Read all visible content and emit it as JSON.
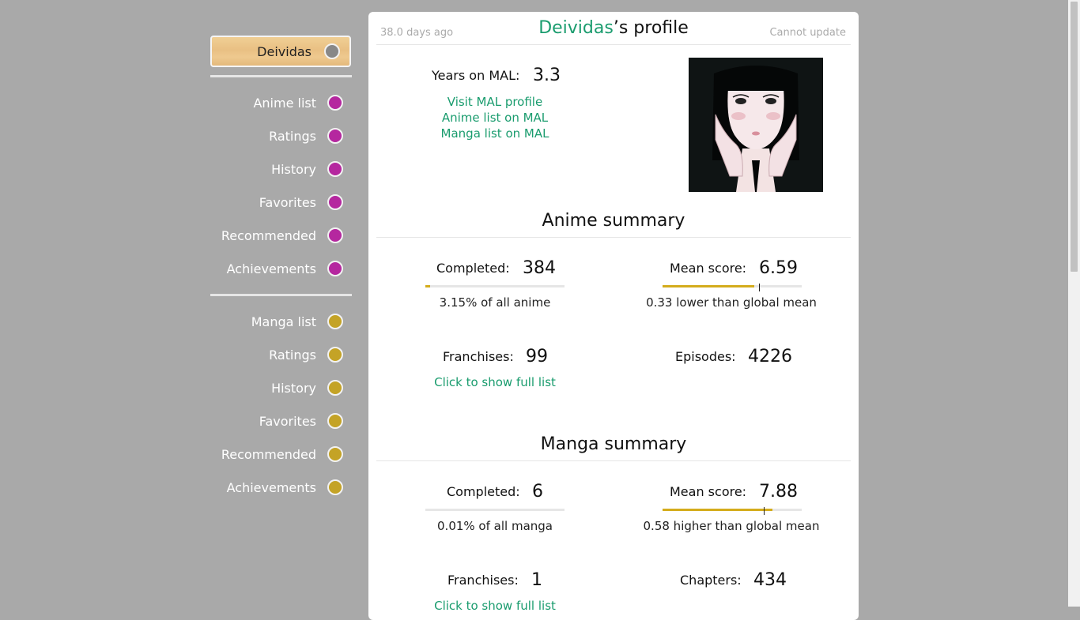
{
  "sidebar": {
    "user": {
      "label": "Deividas",
      "dot_color": "#888888"
    },
    "anime_items": [
      {
        "label": "Anime list"
      },
      {
        "label": "Ratings"
      },
      {
        "label": "History"
      },
      {
        "label": "Favorites"
      },
      {
        "label": "Recommended"
      },
      {
        "label": "Achievements"
      }
    ],
    "manga_items": [
      {
        "label": "Manga list"
      },
      {
        "label": "Ratings"
      },
      {
        "label": "History"
      },
      {
        "label": "Favorites"
      },
      {
        "label": "Recommended"
      },
      {
        "label": "Achievements"
      }
    ],
    "anime_color": "#b5279f",
    "manga_color": "#c4a326"
  },
  "header": {
    "updated": "38.0 days ago",
    "username": "Deividas",
    "title_suffix": "’s profile",
    "cannot_update": "Cannot update"
  },
  "profile": {
    "years_label": "Years on MAL:",
    "years_value": "3.3",
    "links": [
      "Visit MAL profile",
      "Anime list on MAL",
      "Manga list on MAL"
    ]
  },
  "anime": {
    "title": "Anime summary",
    "completed_label": "Completed:",
    "completed_value": "384",
    "completed_fraction": 0.0315,
    "completed_sub": "3.15% of all anime",
    "mean_label": "Mean score:",
    "mean_value": "6.59",
    "mean_fill": 0.659,
    "global_mean": 0.692,
    "mean_sub": "0.33 lower than global mean",
    "franchises_label": "Franchises:",
    "franchises_value": "99",
    "franchises_link": "Click to show full list",
    "episodes_label": "Episodes:",
    "episodes_value": "4226"
  },
  "manga": {
    "title": "Manga summary",
    "completed_label": "Completed:",
    "completed_value": "6",
    "completed_fraction": 0.0001,
    "completed_sub": "0.01% of all manga",
    "mean_label": "Mean score:",
    "mean_value": "7.88",
    "mean_fill": 0.788,
    "global_mean": 0.73,
    "mean_sub": "0.58 higher than global mean",
    "franchises_label": "Franchises:",
    "franchises_value": "1",
    "franchises_link": "Click to show full list",
    "chapters_label": "Chapters:",
    "chapters_value": "434"
  },
  "colors": {
    "accent_green": "#1a9c6e",
    "bar_gold": "#d4ac1c",
    "background": "#a9a9a9"
  }
}
